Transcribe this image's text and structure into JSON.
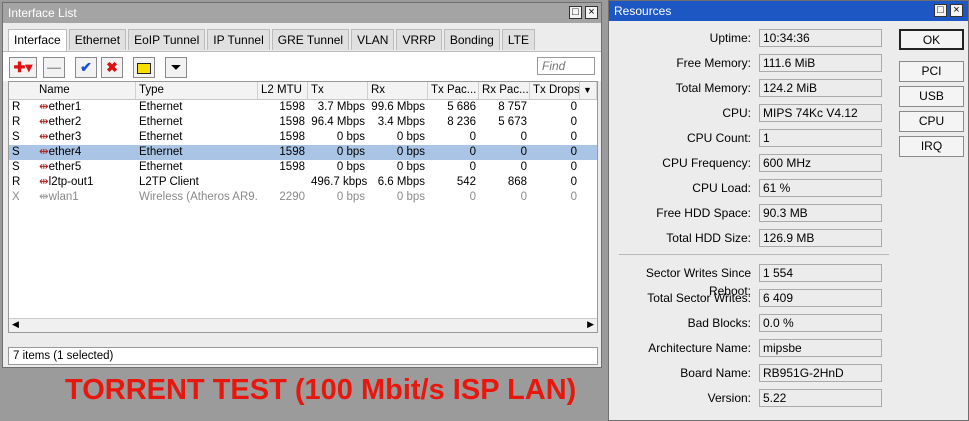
{
  "interface_list": {
    "title": "Interface List",
    "tabs": [
      "Interface",
      "Ethernet",
      "EoIP Tunnel",
      "IP Tunnel",
      "GRE Tunnel",
      "VLAN",
      "VRRP",
      "Bonding",
      "LTE"
    ],
    "find_placeholder": "Find",
    "columns": [
      "",
      "Name",
      "Type",
      "L2 MTU",
      "Tx",
      "Rx",
      "Tx Pac...",
      "Rx Pac...",
      "Tx Drops"
    ],
    "rows": [
      {
        "flag": "R",
        "name": "ether1",
        "type": "Ethernet",
        "mtu": "1598",
        "tx": "3.7 Mbps",
        "rx": "99.6 Mbps",
        "txp": "5 686",
        "rxp": "8 757",
        "txd": "0"
      },
      {
        "flag": "R",
        "name": "ether2",
        "type": "Ethernet",
        "mtu": "1598",
        "tx": "96.4 Mbps",
        "rx": "3.4 Mbps",
        "txp": "8 236",
        "rxp": "5 673",
        "txd": "0"
      },
      {
        "flag": "S",
        "name": "ether3",
        "type": "Ethernet",
        "mtu": "1598",
        "tx": "0 bps",
        "rx": "0 bps",
        "txp": "0",
        "rxp": "0",
        "txd": "0"
      },
      {
        "flag": "S",
        "name": "ether4",
        "type": "Ethernet",
        "mtu": "1598",
        "tx": "0 bps",
        "rx": "0 bps",
        "txp": "0",
        "rxp": "0",
        "txd": "0"
      },
      {
        "flag": "S",
        "name": "ether5",
        "type": "Ethernet",
        "mtu": "1598",
        "tx": "0 bps",
        "rx": "0 bps",
        "txp": "0",
        "rxp": "0",
        "txd": "0"
      },
      {
        "flag": "R",
        "name": "l2tp-out1",
        "type": "L2TP Client",
        "mtu": "",
        "tx": "496.7 kbps",
        "rx": "6.6 Mbps",
        "txp": "542",
        "rxp": "868",
        "txd": "0"
      },
      {
        "flag": "X",
        "name": "wlan1",
        "type": "Wireless (Atheros AR9...",
        "mtu": "2290",
        "tx": "0 bps",
        "rx": "0 bps",
        "txp": "0",
        "rxp": "0",
        "txd": "0"
      }
    ],
    "status": "7 items (1 selected)"
  },
  "caption": "TORRENT TEST (100 Mbit/s ISP LAN)",
  "resources": {
    "title": "Resources",
    "fields": [
      {
        "label": "Uptime:",
        "value": "10:34:36"
      },
      {
        "label": "Free Memory:",
        "value": "111.6 MiB"
      },
      {
        "label": "Total Memory:",
        "value": "124.2 MiB"
      },
      {
        "label": "CPU:",
        "value": "MIPS 74Kc V4.12"
      },
      {
        "label": "CPU Count:",
        "value": "1"
      },
      {
        "label": "CPU Frequency:",
        "value": "600 MHz"
      },
      {
        "label": "CPU Load:",
        "value": "61 %"
      },
      {
        "label": "Free HDD Space:",
        "value": "90.3 MB"
      },
      {
        "label": "Total HDD Size:",
        "value": "126.9 MB"
      },
      {
        "label": "Sector Writes Since Reboot:",
        "value": "1 554"
      },
      {
        "label": "Total Sector Writes:",
        "value": "6 409"
      },
      {
        "label": "Bad Blocks:",
        "value": "0.0 %"
      },
      {
        "label": "Architecture Name:",
        "value": "mipsbe"
      },
      {
        "label": "Board Name:",
        "value": "RB951G-2HnD"
      },
      {
        "label": "Version:",
        "value": "5.22"
      }
    ],
    "buttons": [
      "OK",
      "PCI",
      "USB",
      "CPU",
      "IRQ"
    ]
  },
  "colors": {
    "caption": "#e8170e",
    "selected_row": "#a9c4e4",
    "titlebar": "#a4a4a4"
  }
}
